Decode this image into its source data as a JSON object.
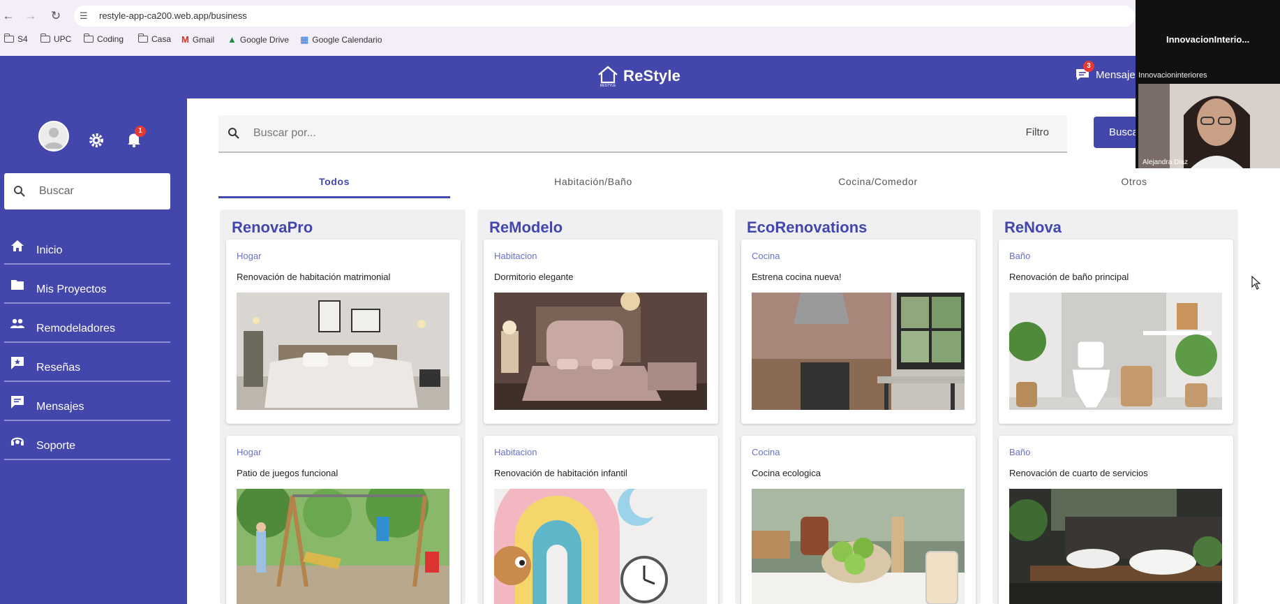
{
  "browser": {
    "url": "restyle-app-ca200.web.app/business",
    "bookmarks": [
      "S4",
      "UPC",
      "Coding",
      "Casa",
      "Gmail",
      "Google Drive",
      "Google Calendario"
    ]
  },
  "header": {
    "app_name": "ReStyle",
    "logo_subtext": "RESTYLE",
    "messages_label": "Mensajes",
    "messages_badge": "3"
  },
  "sidebar": {
    "notification_badge": "1",
    "search_placeholder": "Buscar",
    "items": [
      {
        "label": "Inicio",
        "icon": "home-icon"
      },
      {
        "label": "Mis Proyectos",
        "icon": "folder-icon"
      },
      {
        "label": "Remodeladores",
        "icon": "people-icon"
      },
      {
        "label": "Reseñas",
        "icon": "review-icon"
      },
      {
        "label": "Mensajes",
        "icon": "chat-icon"
      },
      {
        "label": "Soporte",
        "icon": "support-icon"
      }
    ]
  },
  "search": {
    "placeholder": "Buscar por...",
    "filter_label": "Filtro",
    "button_label": "Buscar"
  },
  "tabs": [
    {
      "label": "Todos",
      "active": true
    },
    {
      "label": "Habitación/Baño",
      "active": false
    },
    {
      "label": "Cocina/Comedor",
      "active": false
    },
    {
      "label": "Otros",
      "active": false
    }
  ],
  "businesses": [
    {
      "name": "RenovaPro",
      "projects": [
        {
          "category": "Hogar",
          "title": "Renovación de habitación matrimonial",
          "image": "bedroom-photo"
        },
        {
          "category": "Hogar",
          "title": "Patio de juegos funcional",
          "image": "playground-photo"
        }
      ]
    },
    {
      "name": "ReModelo",
      "projects": [
        {
          "category": "Habitacion",
          "title": "Dormitorio elegante",
          "image": "elegant-bedroom-photo"
        },
        {
          "category": "Habitacion",
          "title": "Renovación de habitación infantil",
          "image": "kids-room-photo"
        }
      ]
    },
    {
      "name": "EcoRenovations",
      "projects": [
        {
          "category": "Cocina",
          "title": "Estrena cocina nueva!",
          "image": "kitchen-photo"
        },
        {
          "category": "Cocina",
          "title": "Cocina ecologica",
          "image": "eco-kitchen-photo"
        }
      ]
    },
    {
      "name": "ReNova",
      "projects": [
        {
          "category": "Baño",
          "title": "Renovación de baño principal",
          "image": "bathroom-photo"
        },
        {
          "category": "Baño",
          "title": "Renovación de cuarto de servicios",
          "image": "service-room-photo"
        }
      ]
    }
  ],
  "video_call": {
    "title": "InnovacionInterio...",
    "subtitle": "Innovacioninteriores",
    "participant": "Alejandra Diaz"
  }
}
